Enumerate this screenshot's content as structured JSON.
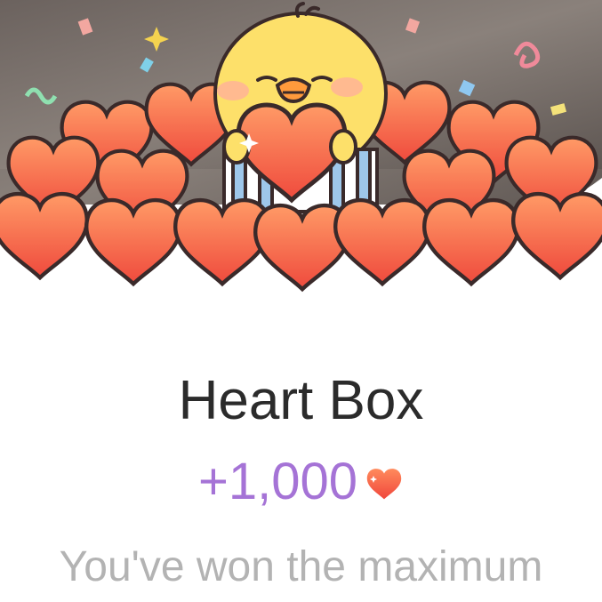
{
  "card": {
    "banner_icon": "chick-hugging-heart-icon",
    "title": "Heart Box",
    "reward_amount": "+1,000",
    "reward_icon": "heart-icon",
    "message": "You've won the maximum"
  },
  "colors": {
    "title": "#2b2b2b",
    "reward": "#a573d6",
    "message": "#b3b3b3",
    "heart_top": "#ff8a5c",
    "heart_bottom": "#f0473c",
    "chick": "#fde06a"
  }
}
